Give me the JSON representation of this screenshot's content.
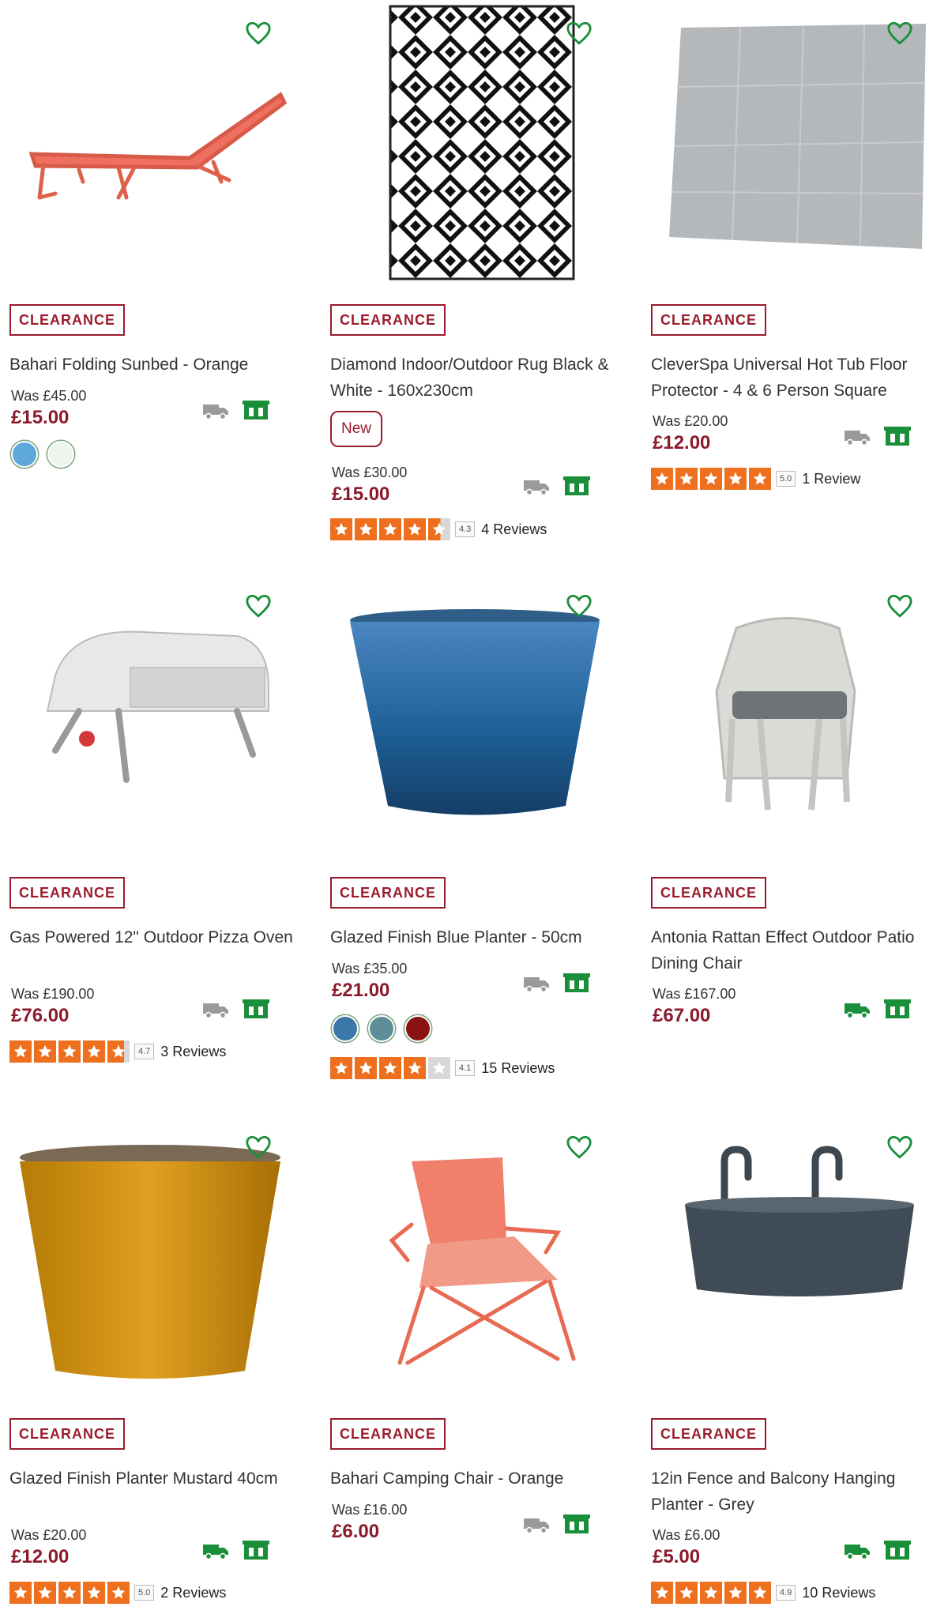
{
  "colors": {
    "brand": "#8b1a2b",
    "badge_border": "#9b1c2c",
    "heart": "#1a8f3a",
    "star": "#ee6f1d",
    "store_green": "#1a8f3a",
    "delivery_grey": "#9a9a9a",
    "delivery_green": "#1a8f3a"
  },
  "products": [
    {
      "badge": "CLEARANCE",
      "title": "Bahari Folding Sunbed - Orange",
      "was": "Was £45.00",
      "price": "£15.00",
      "image": "orange-sunbed",
      "swatches": [
        "#5fa8dc",
        "#eef5ee"
      ],
      "delivery_color": "#9a9a9a"
    },
    {
      "badge": "CLEARANCE",
      "title": "Diamond Indoor/Outdoor Rug Black & White - 160x230cm",
      "new_label": "New",
      "was": "Was £30.00",
      "price": "£15.00",
      "image": "diamond-rug",
      "rating": 4.3,
      "rating_text": "4.3",
      "reviews": "4 Reviews",
      "delivery_color": "#9a9a9a"
    },
    {
      "badge": "CLEARANCE",
      "title": "CleverSpa Universal Hot Tub Floor Protector - 4 & 6 Person Square",
      "was": "Was £20.00",
      "price": "£12.00",
      "image": "floor-protector",
      "rating": 5.0,
      "rating_text": "5.0",
      "reviews": "1 Review",
      "delivery_color": "#9a9a9a"
    },
    {
      "badge": "CLEARANCE",
      "title": "Gas Powered 12\" Outdoor Pizza Oven",
      "was": "Was £190.00",
      "price": "£76.00",
      "image": "pizza-oven",
      "rating": 4.7,
      "rating_text": "4.7",
      "reviews": "3 Reviews",
      "delivery_color": "#9a9a9a"
    },
    {
      "badge": "CLEARANCE",
      "title": "Glazed Finish Blue Planter - 50cm",
      "was": "Was £35.00",
      "price": "£21.00",
      "image": "blue-planter",
      "swatches": [
        "#3b78a8",
        "#5e8f99",
        "#8a1414"
      ],
      "rating": 4.1,
      "rating_text": "4.1",
      "reviews": "15 Reviews",
      "delivery_color": "#9a9a9a"
    },
    {
      "badge": "CLEARANCE",
      "title": "Antonia Rattan Effect Outdoor Patio Dining Chair",
      "was": "Was £167.00",
      "price": "£67.00",
      "image": "rattan-chair",
      "delivery_color": "#1a8f3a"
    },
    {
      "badge": "CLEARANCE",
      "title": "Glazed Finish Planter Mustard 40cm",
      "was": "Was £20.00",
      "price": "£12.00",
      "image": "mustard-planter",
      "rating": 5.0,
      "rating_text": "5.0",
      "reviews": "2 Reviews",
      "delivery_color": "#1a8f3a"
    },
    {
      "badge": "CLEARANCE",
      "title": "Bahari Camping Chair - Orange",
      "was": "Was £16.00",
      "price": "£6.00",
      "image": "camping-chair",
      "delivery_color": "#9a9a9a"
    },
    {
      "badge": "CLEARANCE",
      "title": "12in Fence and Balcony Hanging Planter - Grey",
      "was": "Was £6.00",
      "price": "£5.00",
      "image": "hanging-planter",
      "rating": 4.9,
      "rating_text": "4.9",
      "reviews": "10 Reviews",
      "delivery_color": "#1a8f3a"
    }
  ]
}
